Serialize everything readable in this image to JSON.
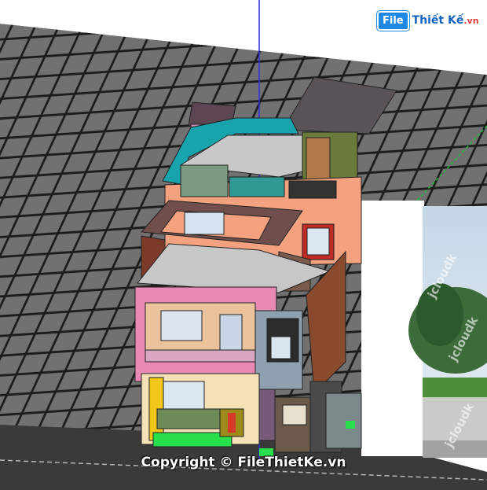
{
  "logo": {
    "badge": "File",
    "name": "Thiết Kế",
    "domain": ".vn"
  },
  "watermark": {
    "copyright": "Copyright © FileThietKe.vn",
    "panel_marks": [
      "jcloudk",
      "jcloudk",
      "jcloudk"
    ]
  },
  "colors": {
    "ground_grid_fill": "#6f6f6f",
    "grid_line": "#222222",
    "wall_peach": "#f2a27e",
    "wall_pink": "#e98ab4",
    "wall_green": "#6a7b3f",
    "roof_dark": "#555055",
    "accent_teal": "#1aa7b0",
    "axis_blue": "#2e2ee0",
    "axis_green": "#1fbf3a",
    "accent_lime": "#27e04c",
    "accent_yellow": "#f2c61b"
  }
}
